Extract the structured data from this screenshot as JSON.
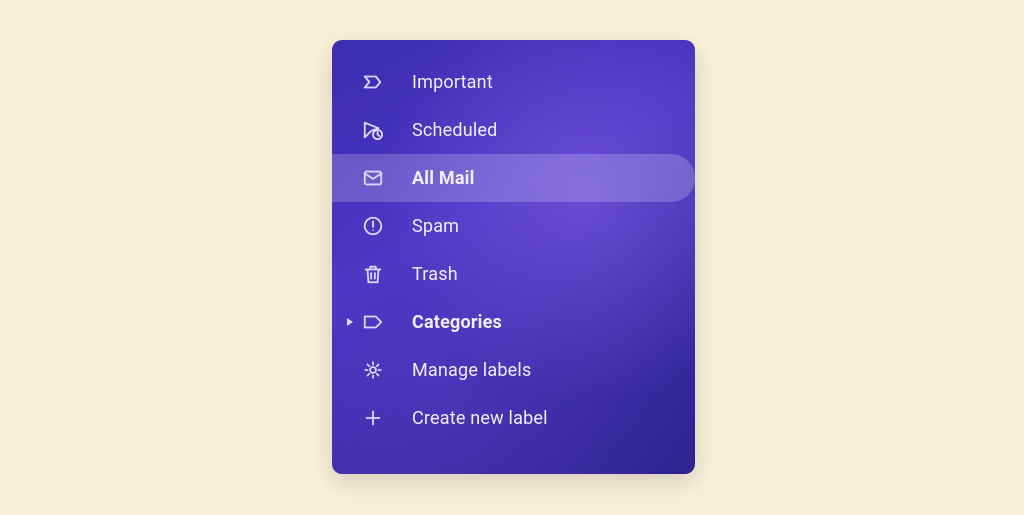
{
  "sidebar": {
    "items": [
      {
        "id": "important",
        "label": "Important",
        "icon": "important-icon",
        "selected": false,
        "bold": false,
        "expandable": false
      },
      {
        "id": "scheduled",
        "label": "Scheduled",
        "icon": "scheduled-icon",
        "selected": false,
        "bold": false,
        "expandable": false
      },
      {
        "id": "all-mail",
        "label": "All Mail",
        "icon": "mail-icon",
        "selected": true,
        "bold": true,
        "expandable": false
      },
      {
        "id": "spam",
        "label": "Spam",
        "icon": "spam-icon",
        "selected": false,
        "bold": false,
        "expandable": false
      },
      {
        "id": "trash",
        "label": "Trash",
        "icon": "trash-icon",
        "selected": false,
        "bold": false,
        "expandable": false
      },
      {
        "id": "categories",
        "label": "Categories",
        "icon": "label-icon",
        "selected": false,
        "bold": true,
        "expandable": true
      },
      {
        "id": "manage",
        "label": "Manage labels",
        "icon": "gear-icon",
        "selected": false,
        "bold": false,
        "expandable": false
      },
      {
        "id": "create",
        "label": "Create new label",
        "icon": "plus-icon",
        "selected": false,
        "bold": false,
        "expandable": false
      }
    ]
  }
}
